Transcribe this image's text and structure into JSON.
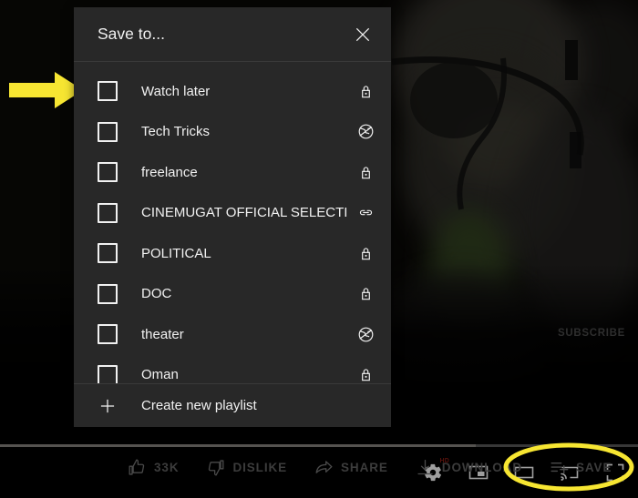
{
  "colors": {
    "dialog_bg": "#282828",
    "page_bg": "#000000",
    "text_primary": "#f1f1f1",
    "annotation_yellow": "#f7e632",
    "action_text": "#3c3c3c",
    "hd_badge": "#8d1c14"
  },
  "dialog": {
    "title": "Save to...",
    "close_icon": "close-icon",
    "items": [
      {
        "label": "Watch later",
        "privacy": "private",
        "privacy_icon": "lock-icon",
        "checked": false
      },
      {
        "label": "Tech Tricks",
        "privacy": "public",
        "privacy_icon": "globe-icon",
        "checked": false
      },
      {
        "label": "freelance",
        "privacy": "private",
        "privacy_icon": "lock-icon",
        "checked": false
      },
      {
        "label": "CINEMUGAT OFFICIAL SELECTION",
        "privacy": "unlisted",
        "privacy_icon": "link-icon",
        "checked": false
      },
      {
        "label": "POLITICAL",
        "privacy": "private",
        "privacy_icon": "lock-icon",
        "checked": false
      },
      {
        "label": "DOC",
        "privacy": "private",
        "privacy_icon": "lock-icon",
        "checked": false
      },
      {
        "label": "theater",
        "privacy": "public",
        "privacy_icon": "globe-icon",
        "checked": false
      },
      {
        "label": "Oman",
        "privacy": "private",
        "privacy_icon": "lock-icon",
        "checked": false
      }
    ],
    "create_new": {
      "label": "Create new playlist",
      "icon": "plus-icon"
    }
  },
  "action_bar": {
    "actions": [
      {
        "label": "33K",
        "icon": "thumbs-up-icon"
      },
      {
        "label": "DISLIKE",
        "icon": "thumbs-down-icon"
      },
      {
        "label": "SHARE",
        "icon": "share-arrow-icon"
      },
      {
        "label": "DOWNLOAD",
        "icon": "download-icon"
      },
      {
        "label": "SAVE",
        "icon": "save-playlist-icon"
      }
    ]
  },
  "player": {
    "subscribe_label": "SUBSCRIBE",
    "quality_badge": "HD",
    "progress_percent": 74.5,
    "controls": [
      {
        "icon": "settings-gear-icon"
      },
      {
        "icon": "miniplayer-icon"
      },
      {
        "icon": "theater-mode-icon"
      },
      {
        "icon": "cast-icon"
      },
      {
        "icon": "fullscreen-icon"
      }
    ]
  },
  "annotations": {
    "arrow": {
      "icon": "yellow-arrow-icon",
      "points_at": "Watch later checkbox"
    },
    "ellipse": {
      "icon": "yellow-ellipse-icon",
      "surrounds": "SAVE"
    }
  }
}
